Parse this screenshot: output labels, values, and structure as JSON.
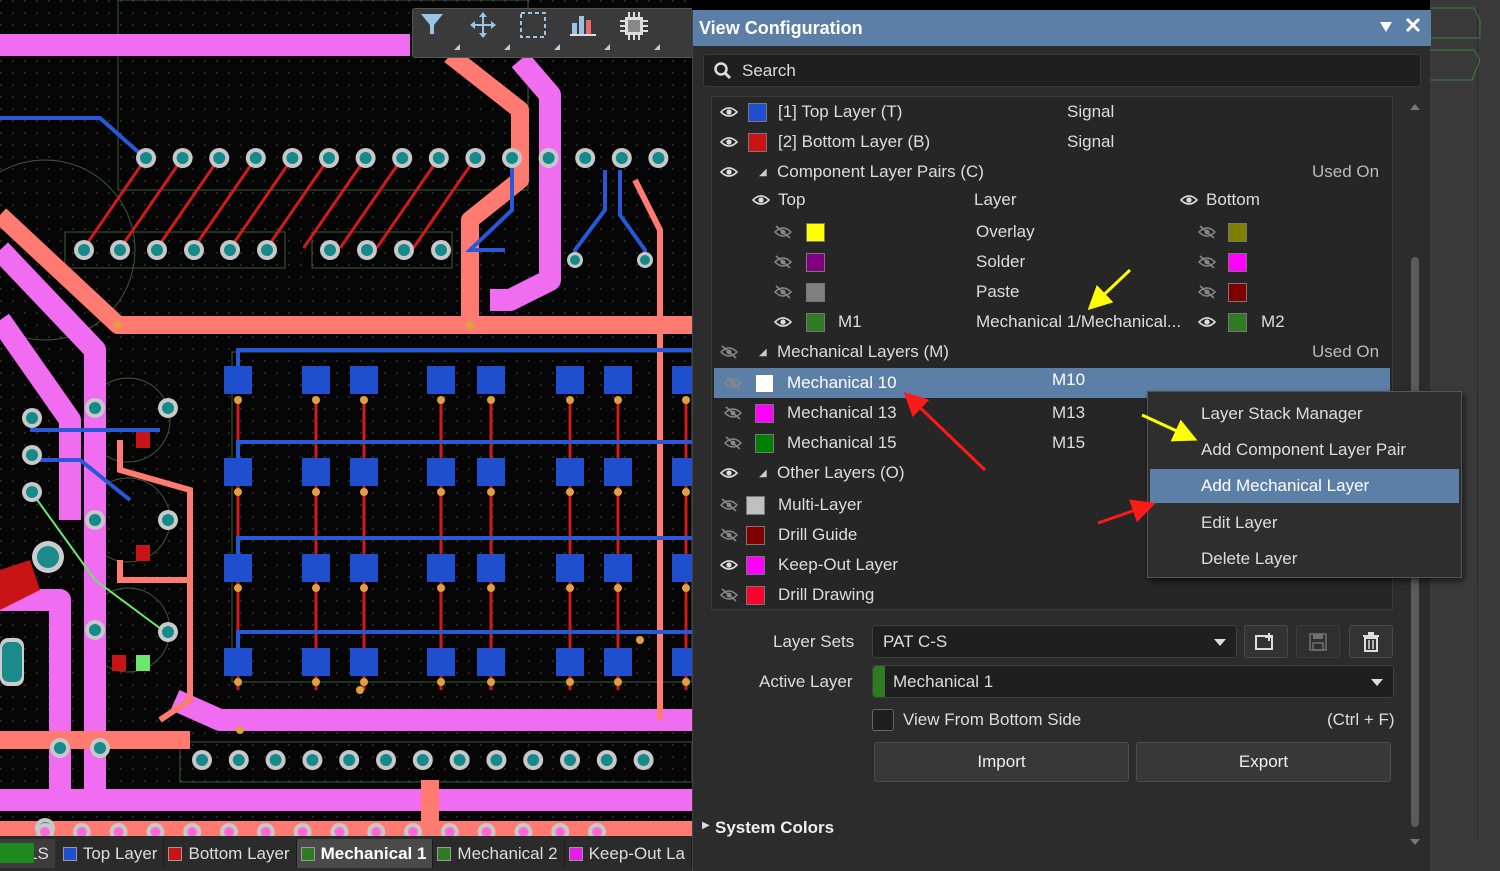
{
  "toolbar": {
    "icons": [
      "filter-icon",
      "move-icon",
      "select-rect-icon",
      "chart-icon",
      "chip-icon"
    ]
  },
  "layer_tabs": {
    "ls_label": "LS",
    "tabs": [
      {
        "label": "Top Layer",
        "color": "#1f4fcf"
      },
      {
        "label": "Bottom Layer",
        "color": "#c81414"
      },
      {
        "label": "Mechanical 1",
        "color": "#2f7a22",
        "active": true
      },
      {
        "label": "Mechanical 2",
        "color": "#2f7a22"
      },
      {
        "label": "Keep-Out La",
        "color": "#e61ee6"
      }
    ]
  },
  "panel": {
    "title": "View Configuration",
    "search_placeholder": "Search",
    "signal_layers": [
      {
        "name": "[1] Top Layer (T)",
        "type": "Signal",
        "color": "#1f4fcf"
      },
      {
        "name": "[2] Bottom Layer (B)",
        "type": "Signal",
        "color": "#c81414"
      }
    ],
    "component_pairs": {
      "group_label": "Component Layer Pairs (C)",
      "used_on": "Used On",
      "col_top": "Top",
      "col_layer": "Layer",
      "col_bottom": "Bottom",
      "rows": [
        {
          "layer": "Overlay",
          "top_color": "#ffff00",
          "bottom_color": "#808000"
        },
        {
          "layer": "Solder",
          "top_color": "#800080",
          "bottom_color": "#ff00ff"
        },
        {
          "layer": "Paste",
          "top_color": "#808080",
          "bottom_color": "#800000"
        },
        {
          "layer": "Mechanical 1/Mechanical...",
          "top_label": "M1",
          "bottom_label": "M2",
          "top_color": "#2f7a22",
          "bottom_color": "#2f7a22"
        }
      ]
    },
    "mechanical": {
      "group_label": "Mechanical Layers (M)",
      "used_on": "Used On",
      "rows": [
        {
          "name": "Mechanical 10",
          "code": "M10",
          "color": "#ffffff"
        },
        {
          "name": "Mechanical 13",
          "code": "M13",
          "color": "#ff00ff"
        },
        {
          "name": "Mechanical 15",
          "code": "M15",
          "color": "#008000"
        }
      ]
    },
    "other": {
      "group_label": "Other Layers (O)",
      "rows": [
        {
          "name": "Multi-Layer",
          "color": "#c0c0c0"
        },
        {
          "name": "Drill Guide",
          "color": "#800000"
        },
        {
          "name": "Keep-Out Layer",
          "color": "#ff00ff"
        },
        {
          "name": "Drill Drawing",
          "color": "#ff002a"
        }
      ]
    },
    "layer_sets_label": "Layer Sets",
    "layer_sets_value": "PAT C-S",
    "active_layer_label": "Active Layer",
    "active_layer_value": "Mechanical 1",
    "view_bottom_label": "View From Bottom Side",
    "view_bottom_shortcut": "(Ctrl + F)",
    "import_label": "Import",
    "export_label": "Export",
    "system_colors_label": "System Colors"
  },
  "context_menu": {
    "items": [
      "Layer Stack Manager",
      "Add Component Layer Pair",
      "Add Mechanical Layer",
      "Edit Layer",
      "Delete Layer"
    ],
    "hovered": "Add Mechanical Layer"
  }
}
